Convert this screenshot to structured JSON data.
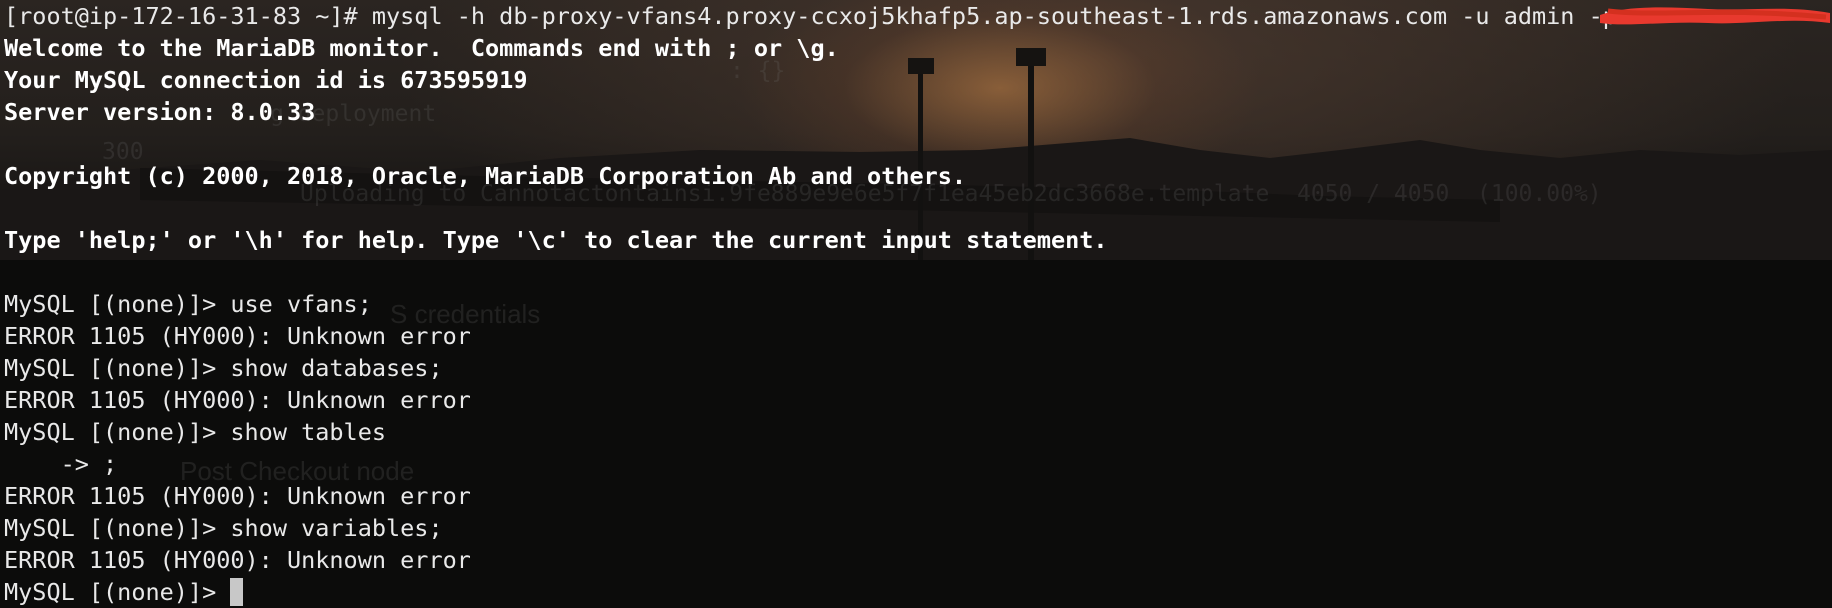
{
  "terminal": {
    "prompt_line": "[root@ip-172-16-31-83 ~]# mysql -h db-proxy-vfans4.proxy-ccxoj5khafp5.ap-southeast-1.rds.amazonaws.com -u admin -p",
    "lines": [
      "Welcome to the MariaDB monitor.  Commands end with ; or \\g.",
      "Your MySQL connection id is 673595919",
      "Server version: 8.0.33",
      "",
      "Copyright (c) 2000, 2018, Oracle, MariaDB Corporation Ab and others.",
      "",
      "Type 'help;' or '\\h' for help. Type '\\c' to clear the current input statement.",
      "",
      "MySQL [(none)]> use vfans;",
      "ERROR 1105 (HY000): Unknown error",
      "MySQL [(none)]> show databases;",
      "ERROR 1105 (HY000): Unknown error",
      "MySQL [(none)]> show tables",
      "    -> ;",
      "ERROR 1105 (HY000): Unknown error",
      "MySQL [(none)]> show variables;",
      "ERROR 1105 (HY000): Unknown error"
    ],
    "current_prompt": "MySQL [(none)]> "
  },
  "background_ghost_text": {
    "ghost_1": ": {}",
    "ghost_2": "g deployment",
    "ghost_3": "300",
    "ghost_4": "Uploading to Cannotactontainsi.9fe889e9e6e5f7f1ea45eb2dc3668e.template  4050 / 4050  (100.00%)",
    "ghost_5": "S credentials",
    "ghost_6": "Post Checkout node"
  },
  "colors": {
    "text": "#e9e9e9",
    "bold_text": "#ffffff",
    "cursor": "#c8c8c8",
    "redaction": "#e8392e"
  }
}
